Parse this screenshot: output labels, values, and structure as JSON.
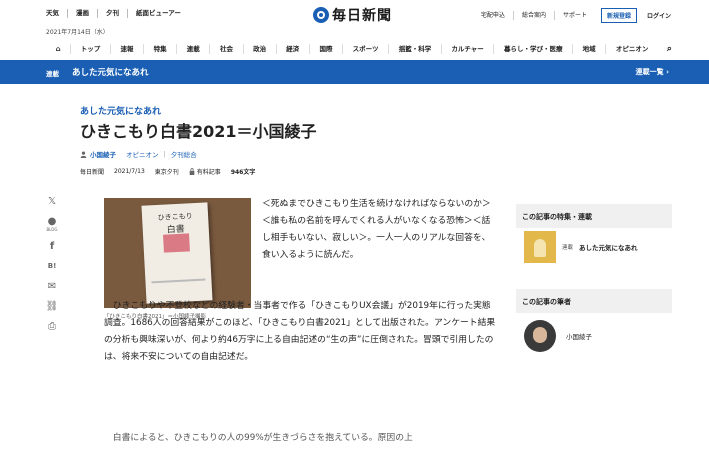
{
  "utility": {
    "weather": "天気",
    "comics": "漫画",
    "evening": "夕刊",
    "viewer": "紙面ビューアー"
  },
  "date": "2021年7月14日（水）",
  "logo_text": "毎日新聞",
  "util_right": {
    "delivery": "宅配申込",
    "info": "総合案内",
    "support": "サポート",
    "register": "新規登録",
    "login": "ログイン"
  },
  "nav": {
    "home_icon": "⌂",
    "items": [
      "トップ",
      "速報",
      "特集",
      "連載",
      "社会",
      "政治",
      "経済",
      "国際",
      "スポーツ",
      "揺籃・科学",
      "カルチャー",
      "暮らし・学び・医療",
      "地域",
      "オピニオン"
    ],
    "search_icon": "⌕"
  },
  "bluebar": {
    "tag": "連載",
    "series": "あした元気になあれ",
    "list": "連載一覧",
    "chevron": "›"
  },
  "article": {
    "kicker": "あした元気になあれ",
    "title": "ひきこもり白書2021＝小国綾子",
    "author": "小国綾子",
    "category": "オピニオン",
    "section": "夕刊総合",
    "sep": "|",
    "publisher": "毎日新聞",
    "date": "2021/7/13",
    "edition": "東京夕刊",
    "paid": "有料記事",
    "wordcount": "946文字"
  },
  "share": {
    "twitter": "𝕏",
    "blog_label": "BLOG",
    "facebook": "f",
    "hatena": "B!",
    "mail": "✉",
    "link": "⛓",
    "print": "⎙"
  },
  "figure": {
    "caption": "「ひきこもり白書2021」＝小国綾子撮影",
    "book_line1": "ひきこもり",
    "book_line2": "白書"
  },
  "body": {
    "p1": "＜死ぬまでひきこもり生活を続けなければならないのか＞＜誰も私の名前を呼んでくれる人がいなくなる恐怖＞＜話し相手もいない、寂しい＞。一人一人のリアルな回答を、食い入るように読んだ。",
    "p2": "　ひきこもりや不登校などの経験者・当事者で作る「ひきこもりUX会議」が2019年に行った実態調査。1686人の回答結果がこのほど、「ひきこもり白書2021」として出版された。アンケート結果の分析も興味深いが、何より約46万字に上る自由記述の“生の声”に圧倒された。冒頭で引用したのは、将来不安についての自由記述だ。",
    "p3": "　白書によると、ひきこもりの人の99%が生きづらさを抱えている。原因の上"
  },
  "sidebar": {
    "series_heading": "この記事の特集・連載",
    "series_tag": "連載",
    "series_name": "あした元気になあれ",
    "author_heading": "この記事の筆者",
    "author_name": "小国綾子"
  }
}
